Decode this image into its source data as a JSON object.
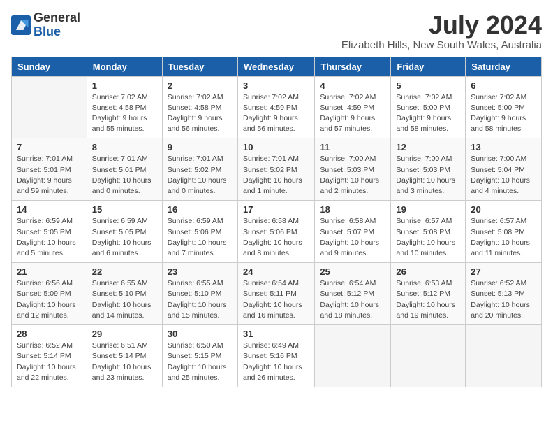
{
  "logo": {
    "text_general": "General",
    "text_blue": "Blue"
  },
  "title": "July 2024",
  "subtitle": "Elizabeth Hills, New South Wales, Australia",
  "headers": [
    "Sunday",
    "Monday",
    "Tuesday",
    "Wednesday",
    "Thursday",
    "Friday",
    "Saturday"
  ],
  "weeks": [
    [
      {
        "day": "",
        "info": ""
      },
      {
        "day": "1",
        "info": "Sunrise: 7:02 AM\nSunset: 4:58 PM\nDaylight: 9 hours\nand 55 minutes."
      },
      {
        "day": "2",
        "info": "Sunrise: 7:02 AM\nSunset: 4:58 PM\nDaylight: 9 hours\nand 56 minutes."
      },
      {
        "day": "3",
        "info": "Sunrise: 7:02 AM\nSunset: 4:59 PM\nDaylight: 9 hours\nand 56 minutes."
      },
      {
        "day": "4",
        "info": "Sunrise: 7:02 AM\nSunset: 4:59 PM\nDaylight: 9 hours\nand 57 minutes."
      },
      {
        "day": "5",
        "info": "Sunrise: 7:02 AM\nSunset: 5:00 PM\nDaylight: 9 hours\nand 58 minutes."
      },
      {
        "day": "6",
        "info": "Sunrise: 7:02 AM\nSunset: 5:00 PM\nDaylight: 9 hours\nand 58 minutes."
      }
    ],
    [
      {
        "day": "7",
        "info": "Sunrise: 7:01 AM\nSunset: 5:01 PM\nDaylight: 9 hours\nand 59 minutes."
      },
      {
        "day": "8",
        "info": "Sunrise: 7:01 AM\nSunset: 5:01 PM\nDaylight: 10 hours\nand 0 minutes."
      },
      {
        "day": "9",
        "info": "Sunrise: 7:01 AM\nSunset: 5:02 PM\nDaylight: 10 hours\nand 0 minutes."
      },
      {
        "day": "10",
        "info": "Sunrise: 7:01 AM\nSunset: 5:02 PM\nDaylight: 10 hours\nand 1 minute."
      },
      {
        "day": "11",
        "info": "Sunrise: 7:00 AM\nSunset: 5:03 PM\nDaylight: 10 hours\nand 2 minutes."
      },
      {
        "day": "12",
        "info": "Sunrise: 7:00 AM\nSunset: 5:03 PM\nDaylight: 10 hours\nand 3 minutes."
      },
      {
        "day": "13",
        "info": "Sunrise: 7:00 AM\nSunset: 5:04 PM\nDaylight: 10 hours\nand 4 minutes."
      }
    ],
    [
      {
        "day": "14",
        "info": "Sunrise: 6:59 AM\nSunset: 5:05 PM\nDaylight: 10 hours\nand 5 minutes."
      },
      {
        "day": "15",
        "info": "Sunrise: 6:59 AM\nSunset: 5:05 PM\nDaylight: 10 hours\nand 6 minutes."
      },
      {
        "day": "16",
        "info": "Sunrise: 6:59 AM\nSunset: 5:06 PM\nDaylight: 10 hours\nand 7 minutes."
      },
      {
        "day": "17",
        "info": "Sunrise: 6:58 AM\nSunset: 5:06 PM\nDaylight: 10 hours\nand 8 minutes."
      },
      {
        "day": "18",
        "info": "Sunrise: 6:58 AM\nSunset: 5:07 PM\nDaylight: 10 hours\nand 9 minutes."
      },
      {
        "day": "19",
        "info": "Sunrise: 6:57 AM\nSunset: 5:08 PM\nDaylight: 10 hours\nand 10 minutes."
      },
      {
        "day": "20",
        "info": "Sunrise: 6:57 AM\nSunset: 5:08 PM\nDaylight: 10 hours\nand 11 minutes."
      }
    ],
    [
      {
        "day": "21",
        "info": "Sunrise: 6:56 AM\nSunset: 5:09 PM\nDaylight: 10 hours\nand 12 minutes."
      },
      {
        "day": "22",
        "info": "Sunrise: 6:55 AM\nSunset: 5:10 PM\nDaylight: 10 hours\nand 14 minutes."
      },
      {
        "day": "23",
        "info": "Sunrise: 6:55 AM\nSunset: 5:10 PM\nDaylight: 10 hours\nand 15 minutes."
      },
      {
        "day": "24",
        "info": "Sunrise: 6:54 AM\nSunset: 5:11 PM\nDaylight: 10 hours\nand 16 minutes."
      },
      {
        "day": "25",
        "info": "Sunrise: 6:54 AM\nSunset: 5:12 PM\nDaylight: 10 hours\nand 18 minutes."
      },
      {
        "day": "26",
        "info": "Sunrise: 6:53 AM\nSunset: 5:12 PM\nDaylight: 10 hours\nand 19 minutes."
      },
      {
        "day": "27",
        "info": "Sunrise: 6:52 AM\nSunset: 5:13 PM\nDaylight: 10 hours\nand 20 minutes."
      }
    ],
    [
      {
        "day": "28",
        "info": "Sunrise: 6:52 AM\nSunset: 5:14 PM\nDaylight: 10 hours\nand 22 minutes."
      },
      {
        "day": "29",
        "info": "Sunrise: 6:51 AM\nSunset: 5:14 PM\nDaylight: 10 hours\nand 23 minutes."
      },
      {
        "day": "30",
        "info": "Sunrise: 6:50 AM\nSunset: 5:15 PM\nDaylight: 10 hours\nand 25 minutes."
      },
      {
        "day": "31",
        "info": "Sunrise: 6:49 AM\nSunset: 5:16 PM\nDaylight: 10 hours\nand 26 minutes."
      },
      {
        "day": "",
        "info": ""
      },
      {
        "day": "",
        "info": ""
      },
      {
        "day": "",
        "info": ""
      }
    ]
  ]
}
